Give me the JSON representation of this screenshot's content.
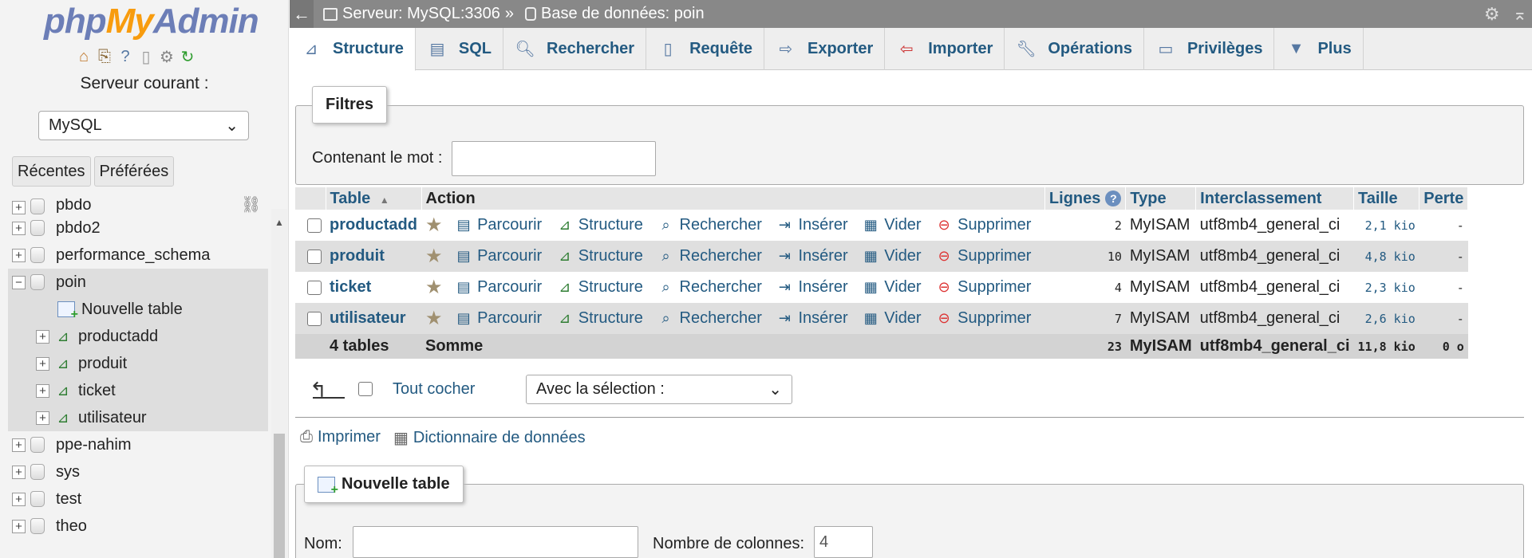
{
  "nav": {
    "logo_php": "php",
    "logo_my": "My",
    "logo_admin": "Admin",
    "icons": [
      "home-icon",
      "exit-icon",
      "help-icon",
      "docs-icon",
      "settings-icon",
      "reload-icon"
    ],
    "server_label": "Serveur courant :",
    "server_value": "MySQL",
    "tab_recent": "Récentes",
    "tab_favorites": "Préférées",
    "tree": [
      {
        "label": "pbdo",
        "level": 0,
        "expander": "+"
      },
      {
        "label": "pbdo2",
        "level": 0,
        "expander": "+"
      },
      {
        "label": "performance_schema",
        "level": 0,
        "expander": "+"
      },
      {
        "label": "poin",
        "level": 0,
        "expander": "−",
        "expanded": true
      },
      {
        "label": "Nouvelle table",
        "level": 1,
        "kind": "new"
      },
      {
        "label": "productadd",
        "level": 1,
        "expander": "+",
        "kind": "table"
      },
      {
        "label": "produit",
        "level": 1,
        "expander": "+",
        "kind": "table"
      },
      {
        "label": "ticket",
        "level": 1,
        "expander": "+",
        "kind": "table"
      },
      {
        "label": "utilisateur",
        "level": 1,
        "expander": "+",
        "kind": "table"
      },
      {
        "label": "ppe-nahim",
        "level": 0,
        "expander": "+"
      },
      {
        "label": "sys",
        "level": 0,
        "expander": "+"
      },
      {
        "label": "test",
        "level": 0,
        "expander": "+"
      },
      {
        "label": "theo",
        "level": 0,
        "expander": "+"
      }
    ]
  },
  "topbar": {
    "server": "Serveur: MySQL:3306",
    "separator": "»",
    "database": "Base de données: poin"
  },
  "tabs": {
    "structure": "Structure",
    "sql": "SQL",
    "search": "Rechercher",
    "query": "Requête",
    "export": "Exporter",
    "import": "Importer",
    "operations": "Opérations",
    "privileges": "Privilèges",
    "more": "Plus"
  },
  "filters": {
    "legend": "Filtres",
    "label": "Contenant le mot :",
    "value": ""
  },
  "table": {
    "headers": {
      "table": "Table",
      "action": "Action",
      "rows": "Lignes",
      "type": "Type",
      "collation": "Interclassement",
      "size": "Taille",
      "overhead": "Perte"
    },
    "actions": {
      "browse": "Parcourir",
      "structure": "Structure",
      "search": "Rechercher",
      "insert": "Insérer",
      "empty": "Vider",
      "drop": "Supprimer"
    },
    "rows": [
      {
        "name": "productadd",
        "rows": "2",
        "type": "MyISAM",
        "collation": "utf8mb4_general_ci",
        "size": "2,1 kio",
        "overhead": "-"
      },
      {
        "name": "produit",
        "rows": "10",
        "type": "MyISAM",
        "collation": "utf8mb4_general_ci",
        "size": "4,8 kio",
        "overhead": "-"
      },
      {
        "name": "ticket",
        "rows": "4",
        "type": "MyISAM",
        "collation": "utf8mb4_general_ci",
        "size": "2,3 kio",
        "overhead": "-"
      },
      {
        "name": "utilisateur",
        "rows": "7",
        "type": "MyISAM",
        "collation": "utf8mb4_general_ci",
        "size": "2,6 kio",
        "overhead": "-"
      }
    ],
    "footer": {
      "count": "4 tables",
      "label": "Somme",
      "rows": "23",
      "type": "MyISAM",
      "collation": "utf8mb4_general_ci",
      "size": "11,8 kio",
      "overhead": "0 o"
    }
  },
  "bulk": {
    "check_all": "Tout cocher",
    "with_selected": "Avec la sélection :"
  },
  "links": {
    "print": "Imprimer",
    "dictionary": "Dictionnaire de données"
  },
  "new_table": {
    "legend": "Nouvelle table",
    "name_label": "Nom:",
    "name_value": "",
    "columns_label": "Nombre de colonnes:",
    "columns_value": "4"
  }
}
